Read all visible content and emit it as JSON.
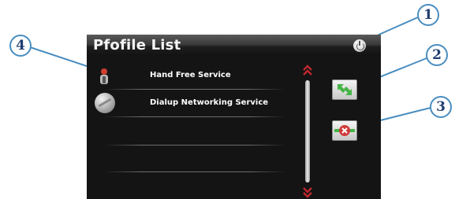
{
  "window": {
    "title": "Pfofile List"
  },
  "profiles": [
    {
      "label": "Hand Free Service",
      "icon": "handsfree-icon"
    },
    {
      "label": "Dialup Networking Service",
      "icon": "dialup-icon"
    }
  ],
  "buttons": {
    "power": {
      "icon": "power-icon"
    },
    "connect": {
      "icon": "connect-arrows-icon"
    },
    "delete": {
      "icon": "delete-x-icon"
    }
  },
  "scroll": {
    "up_icon": "scroll-up-icon",
    "down_icon": "scroll-down-icon"
  },
  "callouts": [
    "1",
    "2",
    "3",
    "4"
  ],
  "colors": {
    "screen_bg": "#141414",
    "callout_border": "#4a8ec0",
    "callout_text": "#1e3c6e",
    "scroll_arrow": "#c0282e",
    "connect_green": "#46b446",
    "delete_red": "#d23c3c"
  }
}
